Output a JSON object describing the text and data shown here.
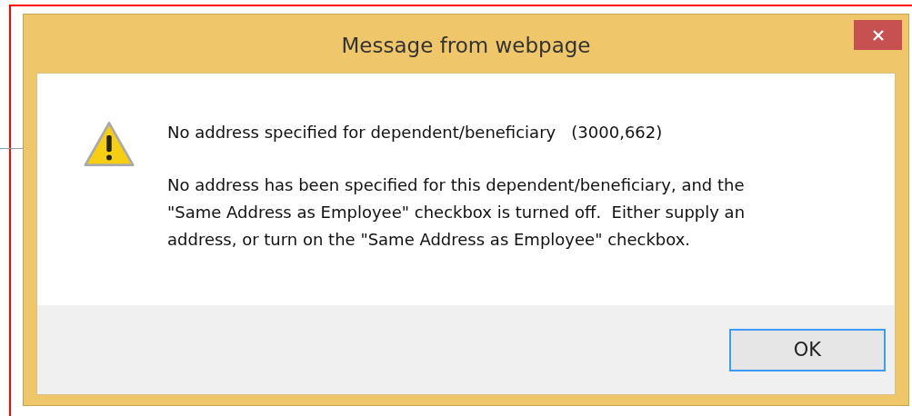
{
  "window": {
    "title": "Message from webpage"
  },
  "message": {
    "heading": "No address specified for dependent/beneficiary   (3000,662)",
    "body_lines": [
      "No address has been specified for this dependent/beneficiary, and the",
      "\"Same Address as Employee\" checkbox is turned off.  Either supply an",
      "address, or turn on the \"Same Address as Employee\" checkbox."
    ]
  },
  "buttons": [
    {
      "label": "OK",
      "focused": true
    }
  ]
}
